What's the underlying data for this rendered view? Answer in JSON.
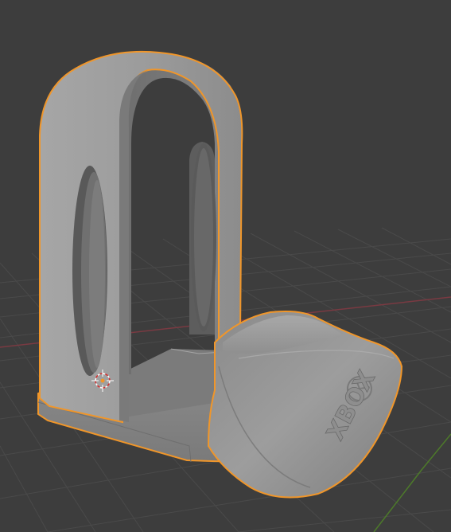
{
  "viewport": {
    "background_color": "#3d3d3d",
    "grid_color": "#4a4a4a",
    "x_axis_color": "#7a3a42",
    "y_axis_color": "#4d7a2a",
    "selection_outline_color": "#f0962a"
  },
  "model": {
    "logo_text": "XBOX",
    "logo_icon": "xbox-logo-icon",
    "body_color": "#9b9b9b",
    "selected": true
  },
  "origin": {
    "icon": "3d-cursor-icon"
  }
}
